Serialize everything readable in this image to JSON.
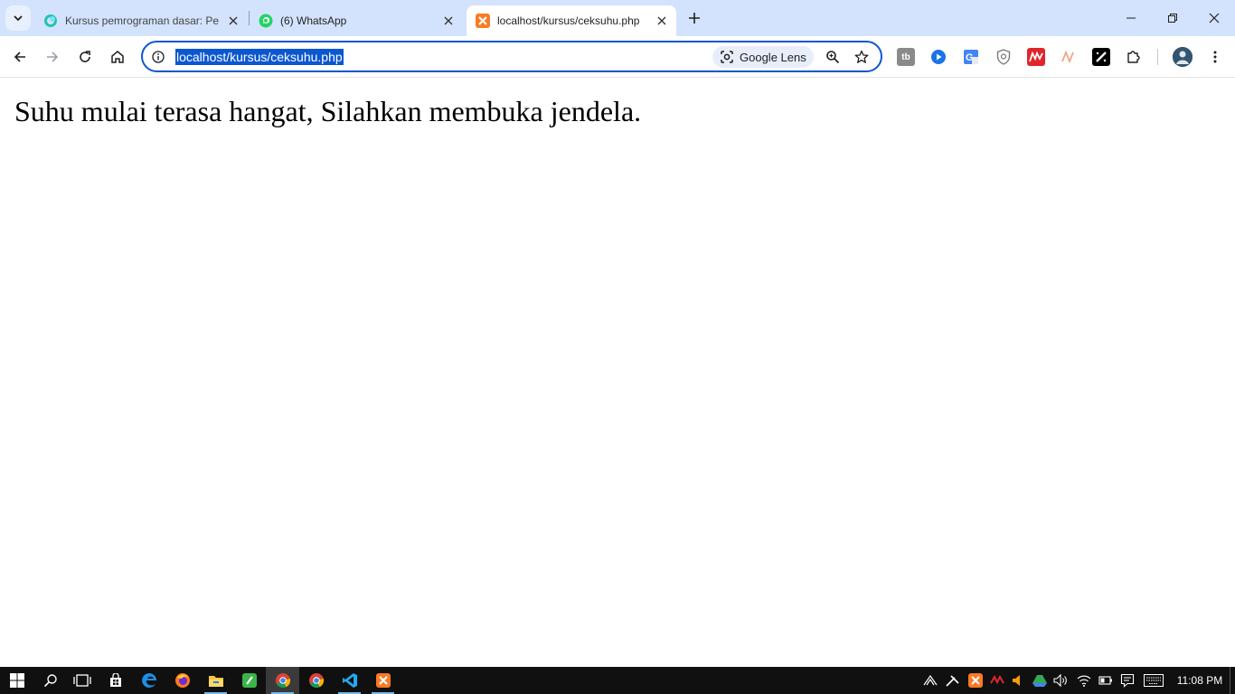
{
  "browser": {
    "tabs": [
      {
        "title": "Kursus pemrograman dasar: Pe",
        "favicon": "codepolitan-icon",
        "active": false
      },
      {
        "title": "(6) WhatsApp",
        "favicon": "whatsapp-icon",
        "active": false
      },
      {
        "title": "localhost/kursus/ceksuhu.php",
        "favicon": "xampp-icon",
        "active": true
      }
    ],
    "address_bar": {
      "url": "localhost/kursus/ceksuhu.php",
      "lens_label": "Google Lens"
    },
    "extensions": [
      "tb-extension-icon",
      "play-extension-icon",
      "google-translate-icon",
      "shield-extension-icon",
      "red-extension-icon",
      "n-extension-icon",
      "slash-extension-icon",
      "puzzle-extensions-icon"
    ],
    "colors": {
      "tabstrip": "#d3e3fd",
      "accent": "#0b57d0"
    }
  },
  "page": {
    "message": "Suhu mulai terasa hangat, Silahkan membuka jendela."
  },
  "taskbar": {
    "apps": [
      "windows-start-icon",
      "search-icon",
      "task-view-icon",
      "store-icon",
      "edge-icon",
      "firefox-icon",
      "file-explorer-icon",
      "notepad-plus-icon",
      "chrome-icon",
      "chrome-alt-icon",
      "vscode-icon",
      "xampp-icon"
    ],
    "clock": "11:08 PM"
  }
}
